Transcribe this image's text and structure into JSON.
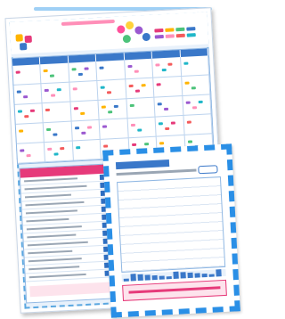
{
  "calendar": {
    "org_line": "",
    "title_line1": "",
    "title_line2": "",
    "date_strip": ""
  },
  "zoom_panel": {
    "header": ""
  },
  "list_panel": {
    "header": ""
  },
  "colors": {
    "blue_accent": "#2a8fe6",
    "dark_blue": "#1e4fa3",
    "pink": "#e63a7a",
    "light_blue_bg": "#e8f1fb"
  }
}
